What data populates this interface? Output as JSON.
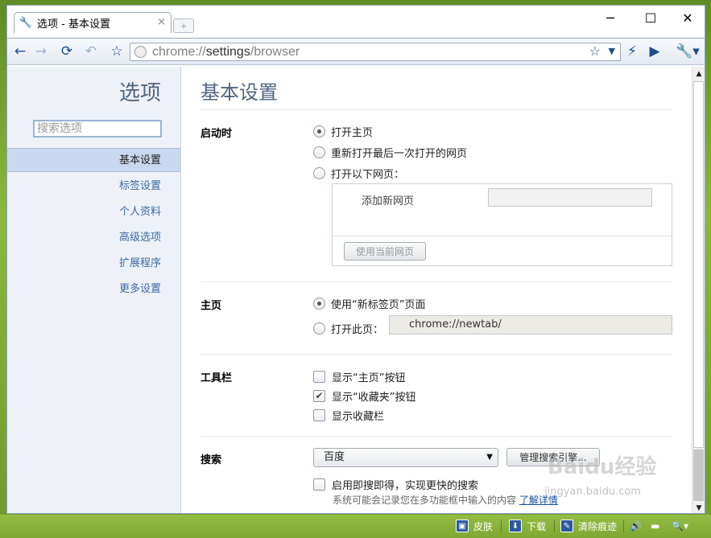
{
  "window": {
    "tab_title": "选项 - 基本设置",
    "tab_close": "×",
    "new_tab": "+",
    "minimize": "─",
    "maximize": "☐",
    "close": "✕"
  },
  "toolbar": {
    "url_prefix": "chrome://",
    "url_host": "settings",
    "url_path": "/browser"
  },
  "sidebar": {
    "title": "选项",
    "search_placeholder": "搜索选项",
    "items": [
      {
        "label": "基本设置",
        "active": true
      },
      {
        "label": "标签设置",
        "active": false
      },
      {
        "label": "个人资料",
        "active": false
      },
      {
        "label": "高级选项",
        "active": false
      },
      {
        "label": "扩展程序",
        "active": false
      },
      {
        "label": "更多设置",
        "active": false
      }
    ]
  },
  "main": {
    "title": "基本设置",
    "startup": {
      "label": "启动时",
      "options": [
        {
          "label": "打开主页",
          "selected": true
        },
        {
          "label": "重新打开最后一次打开的网页",
          "selected": false
        },
        {
          "label": "打开以下网页：",
          "selected": false
        }
      ],
      "add_page_label": "添加新网页",
      "use_current_button": "使用当前网页"
    },
    "homepage": {
      "label": "主页",
      "options": [
        {
          "label": "使用“新标签页”页面",
          "selected": true
        },
        {
          "label": "打开此页：",
          "selected": false
        }
      ],
      "url_value": "chrome://newtab/"
    },
    "toolbar_section": {
      "label": "工具栏",
      "checkboxes": [
        {
          "label": "显示“主页”按钮",
          "checked": false
        },
        {
          "label": "显示“收藏夹”按钮",
          "checked": true
        },
        {
          "label": "显示收藏栏",
          "checked": false
        }
      ]
    },
    "search": {
      "label": "搜索",
      "engine": "百度",
      "manage_button": "管理搜索引擎...",
      "instant_label": "启用即搜即得，实现更快的搜索",
      "instant_checked": false,
      "note": "系统可能会记录您在多功能框中输入的内容",
      "learn_more": "了解详情"
    }
  },
  "statusbar": {
    "skin": "皮肤",
    "download": "下载",
    "clear": "清除痕迹"
  },
  "watermark": {
    "text": "Baidu经验",
    "url": "jingyan.baidu.com"
  }
}
